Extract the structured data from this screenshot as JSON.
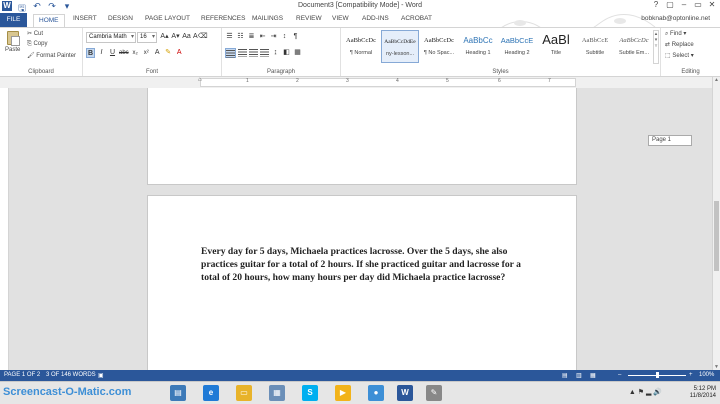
{
  "titlebar": {
    "document_title": "Document3 [Compatibility Mode] - Word",
    "qat_icons": [
      "word-logo-icon",
      "save-icon",
      "undo-icon",
      "redo-icon",
      "customize-qat-icon"
    ],
    "window_controls": [
      "?",
      "▢",
      "–",
      "▭",
      "✕"
    ]
  },
  "tabs": [
    "FILE",
    "HOME",
    "INSERT",
    "DESIGN",
    "PAGE LAYOUT",
    "REFERENCES",
    "MAILINGS",
    "REVIEW",
    "VIEW",
    "ADD-INS",
    "ACROBAT"
  ],
  "active_tab": "HOME",
  "account": "bobknab@optonline.net",
  "ribbon": {
    "clipboard": {
      "paste": "Paste",
      "cut": "Cut",
      "copy": "Copy",
      "format_painter": "Format Painter",
      "label": "Clipboard"
    },
    "font": {
      "font_name": "Cambria Math",
      "font_size": "16",
      "label": "Font"
    },
    "paragraph": {
      "label": "Paragraph"
    },
    "styles": {
      "label": "Styles",
      "items": [
        {
          "sample": "AaBbCcDc",
          "name": "¶ Normal"
        },
        {
          "sample": "AaBbCcDdEe",
          "name": "ny-lesson..."
        },
        {
          "sample": "AaBbCcDc",
          "name": "¶ No Spac..."
        },
        {
          "sample": "AaBbCc",
          "name": "Heading 1"
        },
        {
          "sample": "AaBbCcE",
          "name": "Heading 2"
        },
        {
          "sample": "AaBl",
          "name": "Title"
        },
        {
          "sample": "AaBbCcE",
          "name": "Subtitle"
        },
        {
          "sample": "AaBbCcDc",
          "name": "Subtle Em..."
        }
      ]
    },
    "editing": {
      "find": "Find",
      "replace": "Replace",
      "select": "Select",
      "label": "Editing"
    }
  },
  "ruler_ticks": [
    "1",
    "2",
    "3",
    "4",
    "5",
    "6",
    "7"
  ],
  "document": {
    "paragraph": "Every day for 5 days, Michaela practices lacrosse.  Over the 5 days, she also practices guitar for a total of 2 hours.  If she practiced guitar and lacrosse for a total of 20 hours, how many hours per day did Michaela practice lacrosse?",
    "page_tooltip": "Page 1"
  },
  "statusbar": {
    "page": "PAGE 1 OF 2",
    "words": "3 OF 146 WORDS",
    "zoom": "100%",
    "zoom_level_percent": 100
  },
  "taskbar": {
    "watermark": "Screencast-O-Matic.com",
    "time": "5:12 PM",
    "date": "11/8/2014"
  },
  "colors": {
    "accent": "#2b579a",
    "document_background": "#e1e1e1"
  }
}
